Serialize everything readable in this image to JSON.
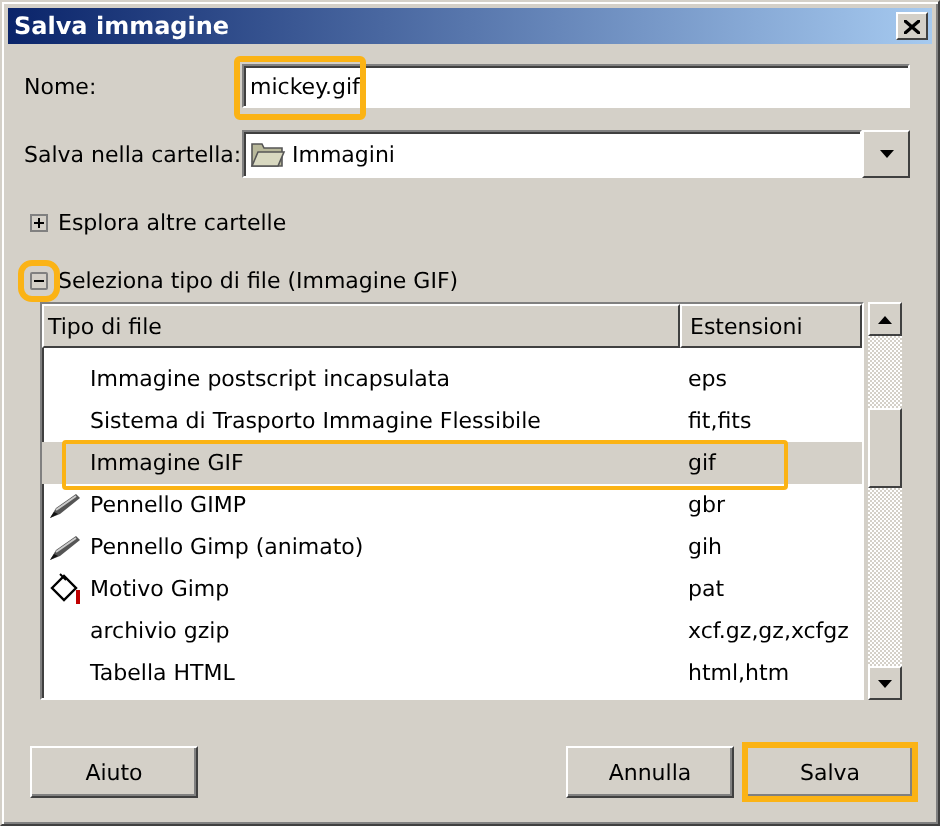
{
  "window": {
    "title": "Salva immagine"
  },
  "name_field": {
    "label": "Nome:",
    "value": "mickey.gif",
    "highlighted": true
  },
  "folder": {
    "label": "Salva nella cartella:",
    "value": "Immagini"
  },
  "browse": {
    "label": "Esplora altre cartelle",
    "expanded": false
  },
  "file_type": {
    "label": "Seleziona tipo di file (Immagine GIF)",
    "expanded": true,
    "highlighted": true
  },
  "table": {
    "columns": [
      "Tipo di file",
      "Estensioni"
    ],
    "rows": [
      {
        "name": "Immagine postscript incapsulata",
        "ext": "eps",
        "kind": "plain",
        "selected": false,
        "highlighted": false
      },
      {
        "name": "Sistema di Trasporto Immagine Flessibile",
        "ext": "fit,fits",
        "kind": "plain",
        "selected": false,
        "highlighted": false
      },
      {
        "name": "Immagine GIF",
        "ext": "gif",
        "kind": "plain",
        "selected": true,
        "highlighted": true
      },
      {
        "name": "Pennello GIMP",
        "ext": "gbr",
        "kind": "brush",
        "selected": false,
        "highlighted": false
      },
      {
        "name": "Pennello Gimp (animato)",
        "ext": "gih",
        "kind": "brush",
        "selected": false,
        "highlighted": false
      },
      {
        "name": "Motivo Gimp",
        "ext": "pat",
        "kind": "bucket",
        "selected": false,
        "highlighted": false
      },
      {
        "name": "archivio gzip",
        "ext": "xcf.gz,gz,xcfgz",
        "kind": "plain",
        "selected": false,
        "highlighted": false
      },
      {
        "name": "Tabella HTML",
        "ext": "html,htm",
        "kind": "plain",
        "selected": false,
        "highlighted": false
      }
    ]
  },
  "buttons": [
    {
      "label": "Aiuto",
      "highlighted": false
    },
    {
      "label": "Annulla",
      "highlighted": false
    },
    {
      "label": "Salva",
      "highlighted": true
    }
  ]
}
